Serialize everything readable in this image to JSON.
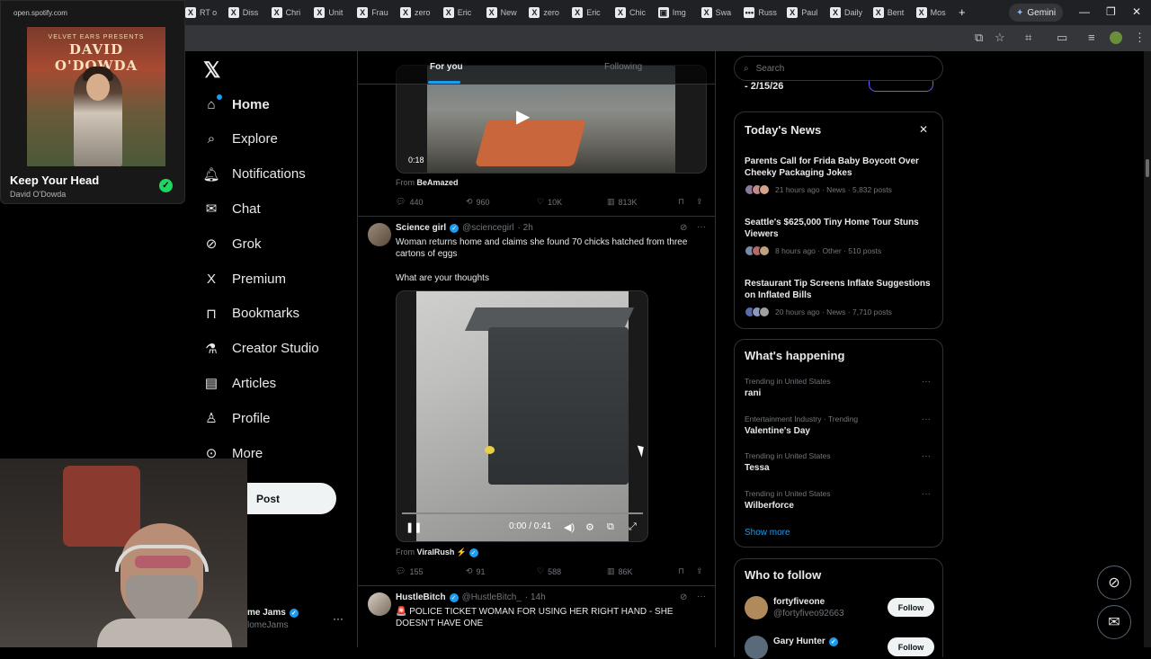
{
  "browser": {
    "tabs": [
      {
        "label": "RT o",
        "icon": "x-icon"
      },
      {
        "label": "Diss",
        "icon": "x-icon"
      },
      {
        "label": "Chri",
        "icon": "x-icon"
      },
      {
        "label": "Unit",
        "icon": "x-icon"
      },
      {
        "label": "Frau",
        "icon": "x-icon"
      },
      {
        "label": "zero",
        "icon": "x-icon"
      },
      {
        "label": "Eric",
        "icon": "x-icon"
      },
      {
        "label": "New",
        "icon": "x-icon"
      },
      {
        "label": "zero",
        "icon": "x-icon"
      },
      {
        "label": "Eric",
        "icon": "x-icon"
      },
      {
        "label": "Chic",
        "icon": "x-icon"
      },
      {
        "label": "Img",
        "icon": "image-icon"
      },
      {
        "label": "Swa",
        "icon": "x-icon"
      },
      {
        "label": "Russ",
        "icon": "dots-icon"
      },
      {
        "label": "Paul",
        "icon": "x-icon"
      },
      {
        "label": "Daily",
        "icon": "x-icon"
      },
      {
        "label": "Bent",
        "icon": "x-icon"
      },
      {
        "label": "Mos",
        "icon": "x-icon"
      }
    ],
    "new_tab": "+",
    "gemini_label": "Gemini"
  },
  "spotify": {
    "url": "open.spotify.com",
    "album_top": "VELVET EARS PRESENTS",
    "album_title": "DAVID O'DOWDA",
    "song": "Keep Your Head",
    "artist": "David O'Dowda"
  },
  "nav": {
    "items": [
      {
        "label": "Home",
        "icon": "home-icon"
      },
      {
        "label": "Explore",
        "icon": "search-icon"
      },
      {
        "label": "Notifications",
        "icon": "bell-icon"
      },
      {
        "label": "Chat",
        "icon": "mail-icon"
      },
      {
        "label": "Grok",
        "icon": "grok-icon"
      },
      {
        "label": "Premium",
        "icon": "x-icon"
      },
      {
        "label": "Bookmarks",
        "icon": "bookmark-icon"
      },
      {
        "label": "Creator Studio",
        "icon": "flask-icon"
      },
      {
        "label": "Articles",
        "icon": "article-icon"
      },
      {
        "label": "Profile",
        "icon": "person-icon"
      },
      {
        "label": "More",
        "icon": "more-circle-icon"
      }
    ],
    "post_label": "Post",
    "account_name": "me Jams",
    "account_handle": "lomeJams"
  },
  "timeline": {
    "tab_for_you": "For you",
    "tab_following": "Following",
    "tweet1": {
      "duration": "0:18",
      "from_label": "From",
      "from_source": "BeAmazed",
      "replies": "440",
      "reposts": "960",
      "likes": "10K",
      "views": "813K"
    },
    "tweet2": {
      "name": "Science girl",
      "handle": "@sciencegirl",
      "time": "· 2h",
      "text_line1": "Woman returns home and claims she found  70 chicks hatched from three cartons of eggs",
      "text_line2": "What are your thoughts",
      "time_display": "0:00 / 0:41",
      "from_label": "From",
      "from_source": "ViralRush ⚡",
      "replies": "155",
      "reposts": "91",
      "likes": "588",
      "views": "86K"
    },
    "tweet3": {
      "name": "HustleBitch",
      "handle": "@HustleBitch_",
      "time": "· 14h",
      "text": "🚨 POLICE TICKET WOMAN FOR USING HER RIGHT HAND - SHE DOESN'T HAVE ONE"
    }
  },
  "sidebar": {
    "search_placeholder": "Search",
    "top_partial": "- 2/15/26",
    "news": {
      "title": "Today's News",
      "items": [
        {
          "title": "Parents Call for Frida Baby Boycott Over Cheeky Packaging Jokes",
          "meta": "21 hours ago · News · 5,832 posts"
        },
        {
          "title": "Seattle's $625,000 Tiny Home Tour Stuns Viewers",
          "meta": "8 hours ago · Other · 510 posts"
        },
        {
          "title": "Restaurant Tip Screens Inflate Suggestions on Inflated Bills",
          "meta": "20 hours ago · News · 7,710 posts"
        }
      ]
    },
    "happening": {
      "title": "What's happening",
      "items": [
        {
          "context": "Trending in United States",
          "name": "rani"
        },
        {
          "context": "Entertainment Industry · Trending",
          "name": "Valentine's Day"
        },
        {
          "context": "Trending in United States",
          "name": "Tessa"
        },
        {
          "context": "Trending in United States",
          "name": "Wilberforce"
        }
      ],
      "show_more": "Show more"
    },
    "who_to_follow": {
      "title": "Who to follow",
      "items": [
        {
          "name": "fortyfiveone",
          "handle": "@fortyfiveo92663",
          "button": "Follow"
        },
        {
          "name": "Gary Hunter",
          "handle": "",
          "button": "Follow"
        }
      ]
    }
  }
}
